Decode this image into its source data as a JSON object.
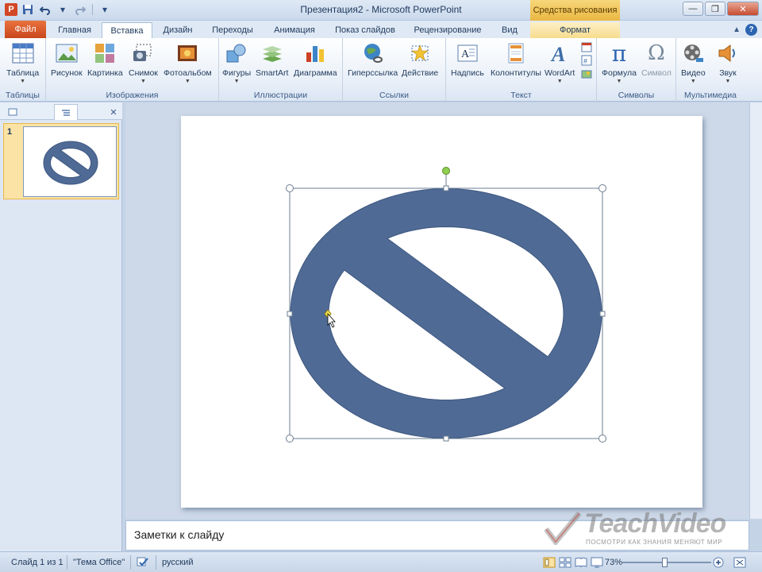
{
  "window": {
    "title": "Презентация2 - Microsoft PowerPoint",
    "context_tab_group": "Средства рисования"
  },
  "tabs": {
    "file": "Файл",
    "items": [
      "Главная",
      "Вставка",
      "Дизайн",
      "Переходы",
      "Анимация",
      "Показ слайдов",
      "Рецензирование",
      "Вид",
      "Формат"
    ],
    "active": "Вставка"
  },
  "ribbon": {
    "tables": {
      "label": "Таблицы",
      "buttons": [
        "Таблица"
      ]
    },
    "images": {
      "label": "Изображения",
      "buttons": [
        "Рисунок",
        "Картинка",
        "Снимок",
        "Фотоальбом"
      ]
    },
    "illustrations": {
      "label": "Иллюстрации",
      "buttons": [
        "Фигуры",
        "SmartArt",
        "Диаграмма"
      ]
    },
    "links": {
      "label": "Ссылки",
      "buttons": [
        "Гиперссылка",
        "Действие"
      ]
    },
    "text": {
      "label": "Текст",
      "buttons": [
        "Надпись",
        "Колонтитулы",
        "WordArt"
      ]
    },
    "symbols": {
      "label": "Символы",
      "buttons": [
        "Формула",
        "Символ"
      ]
    },
    "media": {
      "label": "Мультимедиа",
      "buttons": [
        "Видео",
        "Звук"
      ]
    }
  },
  "slides_panel": {
    "slide_number": "1"
  },
  "notes": {
    "placeholder": "Заметки к слайду"
  },
  "watermark": {
    "brand": "TeachVideo",
    "tagline": "ПОСМОТРИ КАК ЗНАНИЯ МЕНЯЮТ МИР"
  },
  "statusbar": {
    "slide_info": "Слайд 1 из 1",
    "theme": "\"Тема Office\"",
    "language": "русский",
    "zoom": "73%",
    "zoom_level": 0.47
  },
  "colors": {
    "shape_fill": "#4f6b95",
    "shape_outline": "#3d5680",
    "handle": "#ffffff",
    "rotation_handle": "#8fd14f",
    "adjust_handle": "#f5e04a"
  }
}
